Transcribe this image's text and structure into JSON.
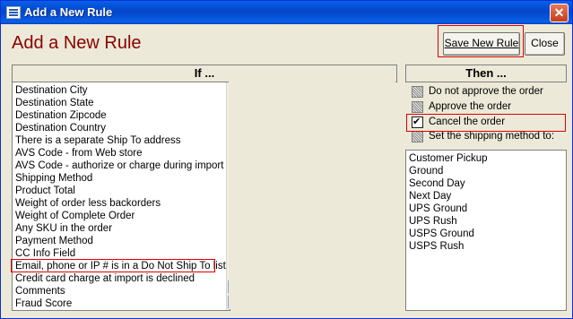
{
  "window": {
    "title": "Add a New Rule",
    "close_glyph": "✕"
  },
  "heading": "Add a New Rule",
  "buttons": {
    "save": "Save New Rule",
    "close": "Close"
  },
  "if_panel": {
    "header": "If ...",
    "items": [
      "Destination City",
      "Destination State",
      "Destination Zipcode",
      "Destination Country",
      "There is a separate Ship To address",
      "AVS Code - from Web store",
      "AVS Code - authorize or charge during import",
      "Shipping Method",
      "Product Total",
      "Weight of order less backorders",
      "Weight of Complete Order",
      "Any SKU in the order",
      "Payment Method",
      "CC Info Field",
      "Email, phone or IP # is in a Do Not Ship To list",
      "Credit card charge at import is declined",
      "Comments",
      "Fraud Score"
    ]
  },
  "then_panel": {
    "header": "Then ...",
    "options": [
      {
        "label": "Do not approve the order",
        "state": "indeterminate"
      },
      {
        "label": "Approve the order",
        "state": "indeterminate"
      },
      {
        "label": "Cancel the order",
        "state": "checked"
      },
      {
        "label": "Set the shipping method to:",
        "state": "indeterminate"
      }
    ],
    "shipping_methods": [
      "Customer Pickup",
      "Ground",
      "Second Day",
      "Next Day",
      "UPS Ground",
      "UPS Rush",
      "USPS Ground",
      "USPS Rush"
    ]
  }
}
